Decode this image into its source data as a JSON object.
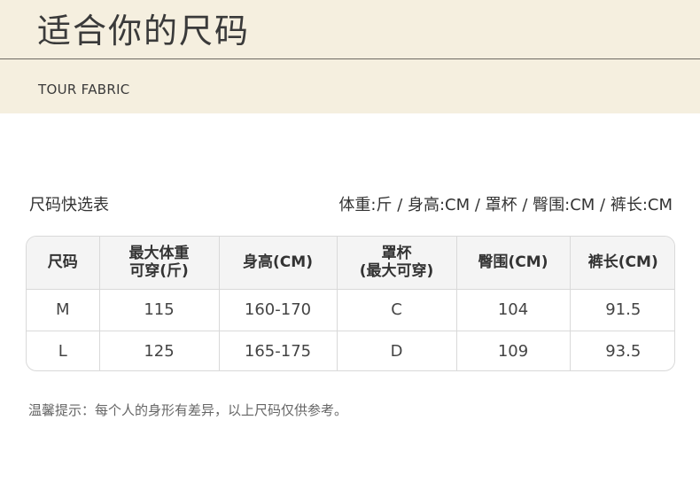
{
  "header": {
    "title": "适合你的尺码",
    "brand": "TOUR FABRIC"
  },
  "table_label": "尺码快选表",
  "units": "体重:斤 / 身高:CM / 罩杯 / 臀围:CM / 裤长:CM",
  "table": {
    "headers": [
      [
        "尺码"
      ],
      [
        "最大体重",
        "可穿(斤)"
      ],
      [
        "身高(CM)"
      ],
      [
        "罩杯",
        "(最大可穿)"
      ],
      [
        "臀围(CM)"
      ],
      [
        "裤长(CM)"
      ]
    ],
    "rows": [
      [
        "M",
        "115",
        "160-170",
        "C",
        "104",
        "91.5"
      ],
      [
        "L",
        "125",
        "165-175",
        "D",
        "109",
        "93.5"
      ]
    ]
  },
  "tip": "温馨提示：每个人的身形有差异，以上尺码仅供参考。"
}
